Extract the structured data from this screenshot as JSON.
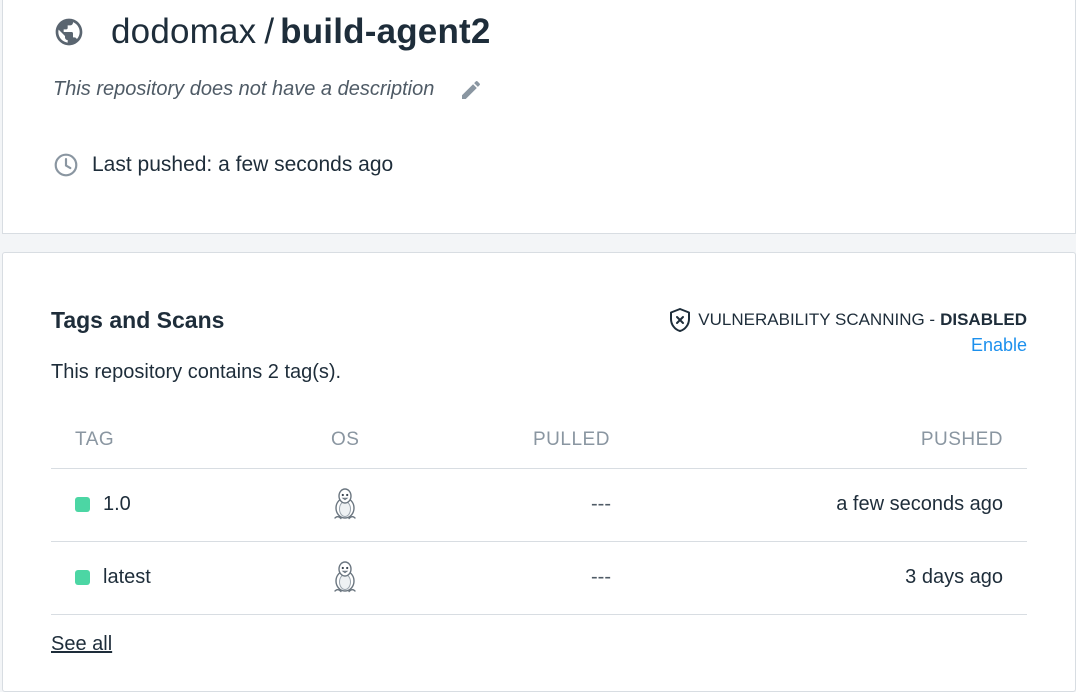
{
  "repo": {
    "owner": "dodomax",
    "separator": "/",
    "name": "build-agent2",
    "description": "This repository does not have a description",
    "last_pushed_label": "Last pushed: a few seconds ago",
    "visibility_icon": "globe-icon",
    "edit_icon": "pencil-icon",
    "clock_icon": "clock-icon"
  },
  "tags_section": {
    "title": "Tags and Scans",
    "count_text": "This repository contains 2 tag(s).",
    "vuln_label": "VULNERABILITY SCANNING -",
    "vuln_state": "DISABLED",
    "enable_label": "Enable",
    "shield_icon": "shield-x-icon",
    "columns": [
      "TAG",
      "OS",
      "PULLED",
      "PUSHED"
    ],
    "rows": [
      {
        "tag": "1.0",
        "os": "linux-penguin-icon",
        "pulled": "---",
        "pushed": "a few seconds ago"
      },
      {
        "tag": "latest",
        "os": "linux-penguin-icon",
        "pulled": "---",
        "pushed": "3 days ago"
      }
    ],
    "see_all_label": "See all"
  },
  "colors": {
    "accent_link": "#1c90ed",
    "tag_status": "#4cd6a4",
    "text_primary": "#1e2d3a",
    "text_muted": "#8a96a1"
  }
}
